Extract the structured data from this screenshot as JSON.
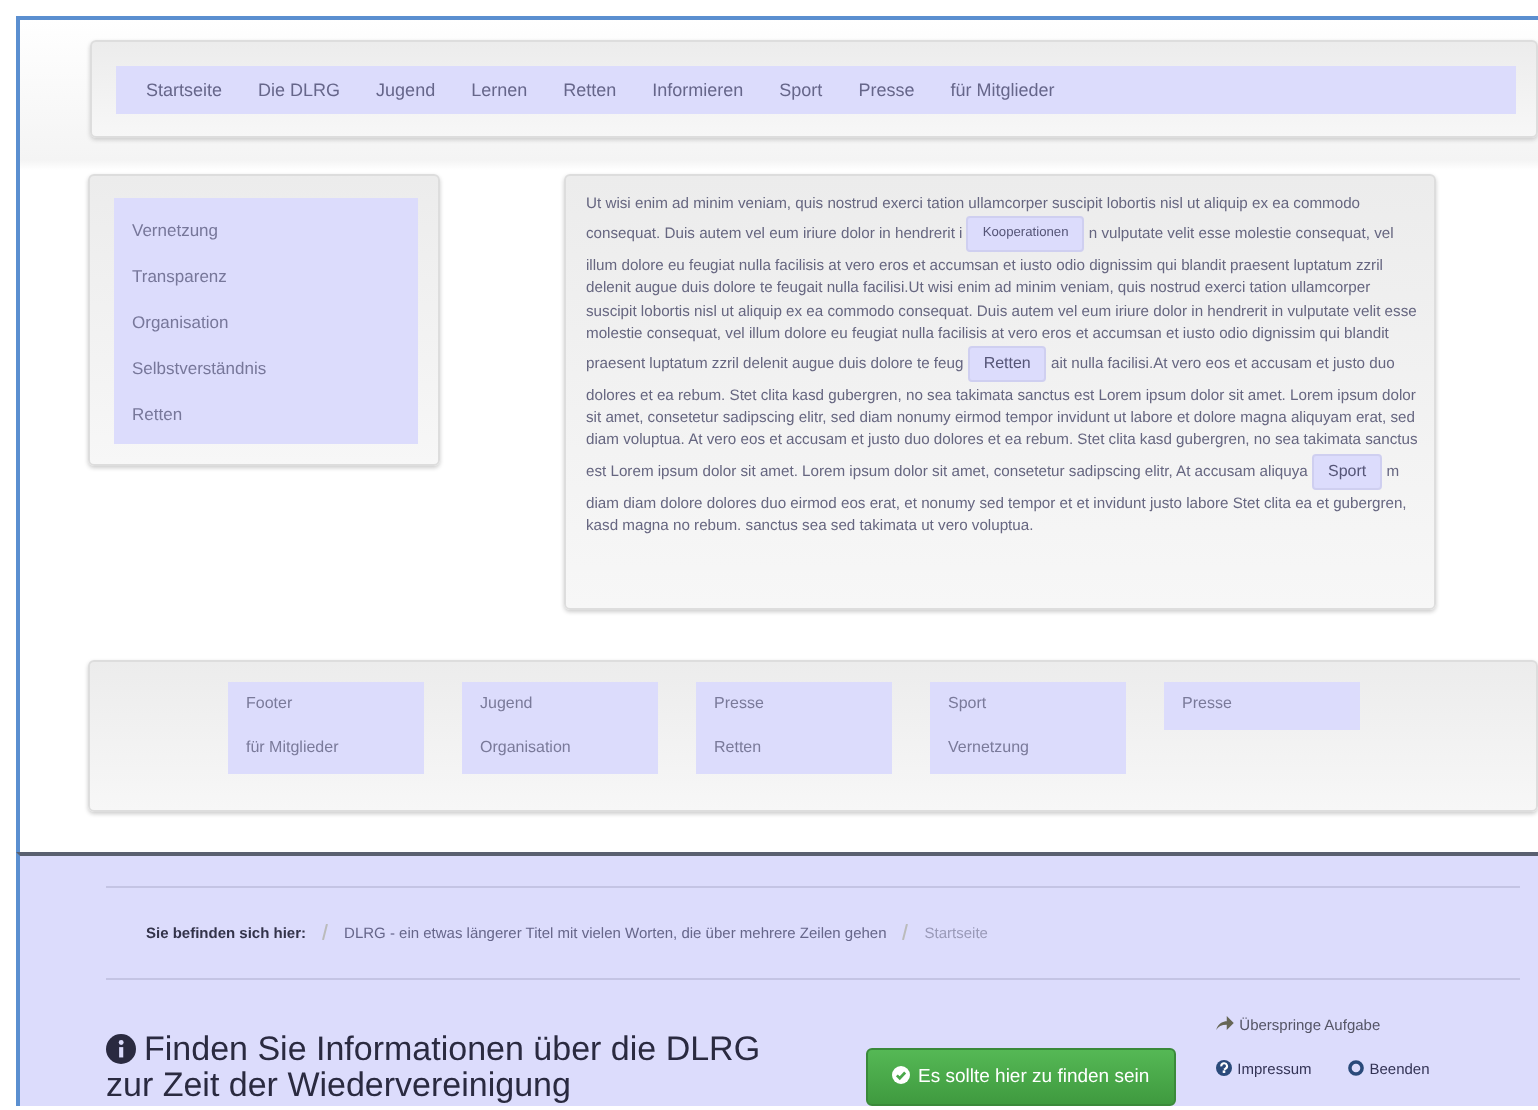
{
  "nav": {
    "items": [
      "Startseite",
      "Die DLRG",
      "Jugend",
      "Lernen",
      "Retten",
      "Informieren",
      "Sport",
      "Presse",
      "für Mitglieder"
    ]
  },
  "sidebar": {
    "items": [
      "Vernetzung",
      "Transparenz",
      "Organisation",
      "Selbstverständnis",
      "Retten"
    ]
  },
  "article": {
    "segments": [
      {
        "kind": "text",
        "text": "Ut wisi enim ad minim veniam, quis nostrud exerci tation ullamcorper suscipit lobortis nisl ut aliquip ex ea commodo consequat. Duis autem vel eum iriure dolor in hendrerit i"
      },
      {
        "kind": "link",
        "text": "Kooperationen"
      },
      {
        "kind": "text",
        "text": "n vulputate velit esse molestie consequat, vel illum dolore eu feugiat nulla facilisis at vero eros et accumsan et iusto odio dignissim qui blandit praesent luptatum zzril delenit augue duis dolore te feugait nulla facilisi.Ut wisi enim ad minim veniam, quis nostrud exerci tation ullamcorper suscipit lobortis nisl ut aliquip ex ea commodo consequat. Duis autem vel eum iriure dolor in hendrerit in vulputate velit esse molestie consequat, vel illum dolore eu feugiat nulla facilisis at vero eros et accumsan et iusto odio dignissim qui blandit praesent luptatum zzril delenit augue duis dolore te feug"
      },
      {
        "kind": "link",
        "text": "Retten"
      },
      {
        "kind": "text",
        "text": "ait nulla facilisi.At vero eos et accusam et justo duo dolores et ea rebum. Stet clita kasd gubergren, no sea takimata sanctus est Lorem ipsum dolor sit amet. Lorem ipsum dolor sit amet, consetetur sadipscing elitr, sed diam nonumy eirmod tempor invidunt ut labore et dolore magna aliquyam erat, sed diam voluptua. At vero eos et accusam et justo duo dolores et ea rebum. Stet clita kasd gubergren, no sea takimata sanctus est Lorem ipsum dolor sit amet. Lorem ipsum dolor sit amet, consetetur sadipscing elitr, At accusam aliquya"
      },
      {
        "kind": "link",
        "text": "Sport"
      },
      {
        "kind": "text",
        "text": "m diam diam dolore dolores duo eirmod eos erat, et nonumy sed tempor et et invidunt justo labore Stet clita ea et gubergren, kasd magna no rebum. sanctus sea sed takimata ut vero voluptua."
      }
    ]
  },
  "footer": {
    "columns": [
      [
        "Footer",
        "für Mitglieder"
      ],
      [
        "Jugend",
        "Organisation"
      ],
      [
        "Presse",
        "Retten"
      ],
      [
        "Sport",
        "Vernetzung"
      ],
      [
        "Presse"
      ]
    ]
  },
  "task": {
    "breadcrumb_label": "Sie befinden sich hier:",
    "breadcrumb": [
      "DLRG - ein etwas längerer Titel mit vielen Worten, die über mehrere Zeilen gehen",
      "Startseite"
    ],
    "question": "Finden Sie Informationen über die DLRG zur Zeit der Wiedervereinigung",
    "answer_button": "Es sollte hier zu finden sein",
    "skip_link": "Überspringe Aufgabe",
    "links": [
      "Impressum",
      "Beenden"
    ]
  }
}
